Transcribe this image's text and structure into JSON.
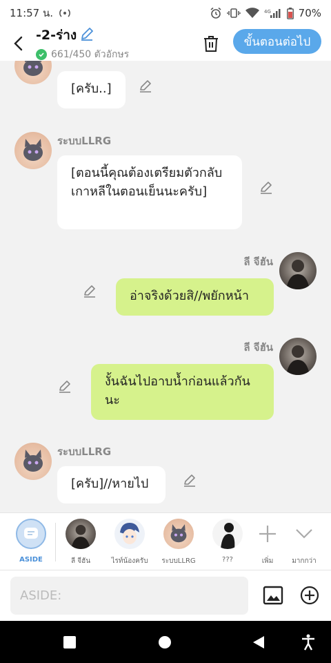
{
  "status": {
    "time": "11:57 น.",
    "battery": "70%",
    "network": "4G"
  },
  "header": {
    "title": "-2-ร่าง",
    "char_count": "661/450 ตัวอักษร",
    "next_label": "ขั้นตอนต่อไป"
  },
  "messages": [
    {
      "sender": "",
      "text": "[ครับ..]",
      "side": "left"
    },
    {
      "sender": "ระบบLLRG",
      "text": "[ตอนนี้คุณต้องเตรียมตัวกลับเกาหลีในตอนเย็นนะครับ]",
      "side": "left"
    },
    {
      "sender": "ลี จีฮัน",
      "text": "อ่าจริงด้วยสิ//พยักหน้า",
      "side": "right"
    },
    {
      "sender": "ลี จีฮัน",
      "text": "งั้นฉันไปอาบน้ำก่อนแล้วกันนะ",
      "side": "right"
    },
    {
      "sender": "ระบบLLRG",
      "text": "[ครับ]//หายไป",
      "side": "left"
    }
  ],
  "characters": [
    {
      "label": "ASIDE"
    },
    {
      "label": "ลี จีฮัน"
    },
    {
      "label": "ไรท์น้องครับ"
    },
    {
      "label": "ระบบLLRG"
    },
    {
      "label": "???"
    }
  ],
  "actions": {
    "add_label": "เพิ่ม",
    "more_label": "มากกว่า"
  },
  "input": {
    "placeholder": "ASIDE:"
  },
  "colors": {
    "accent": "#5aa8ea",
    "my_bubble": "#d6f28c",
    "verified": "#3dbf6a"
  }
}
